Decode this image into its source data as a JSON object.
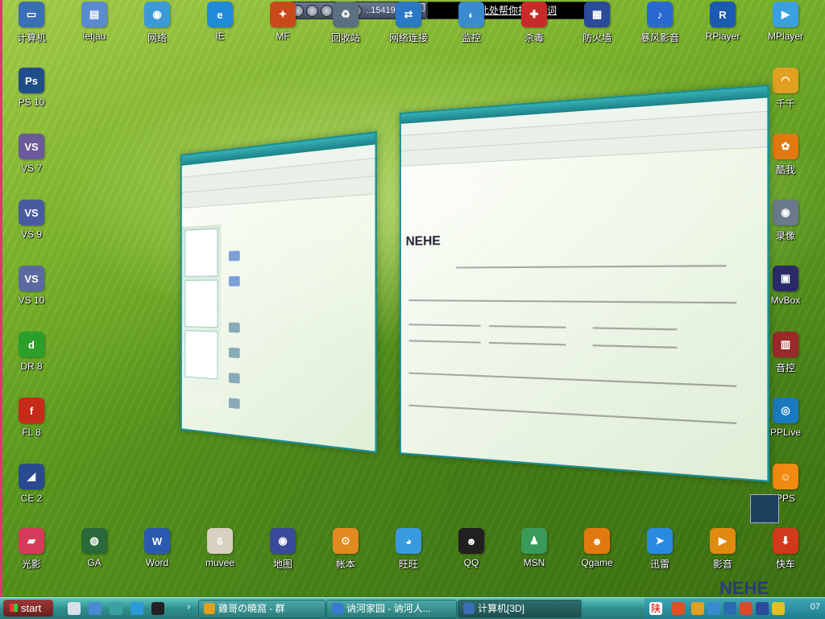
{
  "desktop": {
    "icons": [
      {
        "label": "计算机",
        "glyph": "▭",
        "color": "#3a6fb5",
        "col": 0,
        "row": 0
      },
      {
        "label": "letjau",
        "glyph": "▤",
        "color": "#5a8ad0",
        "col": 1,
        "row": 0
      },
      {
        "label": "网络",
        "glyph": "◉",
        "color": "#3d9ad8",
        "col": 2,
        "row": 0
      },
      {
        "label": "IE",
        "glyph": "e",
        "color": "#1f8ad8",
        "col": 3,
        "row": 0
      },
      {
        "label": "MF",
        "glyph": "✦",
        "color": "#c84a1a",
        "col": 4,
        "row": 0
      },
      {
        "label": "回收站",
        "glyph": "♻",
        "color": "#5a7080",
        "col": 5,
        "row": 0
      },
      {
        "label": "网络连接",
        "glyph": "⇄",
        "color": "#2b78c4",
        "col": 6,
        "row": 0
      },
      {
        "label": "监控",
        "glyph": "◐",
        "color": "#3a8ad0",
        "col": 7,
        "row": 0
      },
      {
        "label": "杀毒",
        "glyph": "✚",
        "color": "#c82a2a",
        "col": 8,
        "row": 0
      },
      {
        "label": "防火墙",
        "glyph": "▦",
        "color": "#2a4a9a",
        "col": 9,
        "row": 0
      },
      {
        "label": "暴风影音",
        "glyph": "♪",
        "color": "#2a6ad0",
        "col": 10,
        "row": 0
      },
      {
        "label": "RPlayer",
        "glyph": "R",
        "color": "#1a5ab0",
        "col": 11,
        "row": 0
      },
      {
        "label": "MPlayer",
        "glyph": "▶",
        "color": "#3aa0e0",
        "col": 12,
        "row": 0
      },
      {
        "label": "PS 10",
        "glyph": "Ps",
        "color": "#1f4d8a",
        "col": 0,
        "row": 1
      },
      {
        "label": "VS 7",
        "glyph": "VS",
        "color": "#6a5a9a",
        "col": 0,
        "row": 2
      },
      {
        "label": "VS 9",
        "glyph": "VS",
        "color": "#4a5aa0",
        "col": 0,
        "row": 3
      },
      {
        "label": "VS 10",
        "glyph": "VS",
        "color": "#5a6aa0",
        "col": 0,
        "row": 4
      },
      {
        "label": "DR 8",
        "glyph": "d",
        "color": "#2aa02a",
        "col": 0,
        "row": 5
      },
      {
        "label": "FL 8",
        "glyph": "f",
        "color": "#c82a1a",
        "col": 0,
        "row": 6
      },
      {
        "label": "CE 2",
        "glyph": "◢",
        "color": "#2a4a90",
        "col": 0,
        "row": 7
      },
      {
        "label": "千千",
        "glyph": "◠",
        "color": "#e0a020",
        "col": 12,
        "row": 1
      },
      {
        "label": "酷我",
        "glyph": "✿",
        "color": "#e07a10",
        "col": 12,
        "row": 2
      },
      {
        "label": "录像",
        "glyph": "◉",
        "color": "#6a7a8a",
        "col": 12,
        "row": 3
      },
      {
        "label": "MvBox",
        "glyph": "▣",
        "color": "#2a2a6a",
        "col": 12,
        "row": 4
      },
      {
        "label": "音控",
        "glyph": "▥",
        "color": "#9a2a2a",
        "col": 12,
        "row": 5
      },
      {
        "label": "PPLive",
        "glyph": "◎",
        "color": "#1a7ac0",
        "col": 12,
        "row": 6
      },
      {
        "label": "PPS",
        "glyph": "☺",
        "color": "#f08a10",
        "col": 12,
        "row": 7
      },
      {
        "label": "光影",
        "glyph": "▰",
        "color": "#d83a5a",
        "col": 0,
        "row": 8
      },
      {
        "label": "GA",
        "glyph": "◍",
        "color": "#2a6a3a",
        "col": 1,
        "row": 8
      },
      {
        "label": "Word",
        "glyph": "W",
        "color": "#2a5ab0",
        "col": 2,
        "row": 8
      },
      {
        "label": "muvee",
        "glyph": "6",
        "color": "#d8d0c0",
        "col": 3,
        "row": 8
      },
      {
        "label": "地图",
        "glyph": "◉",
        "color": "#3a4a9a",
        "col": 4,
        "row": 8
      },
      {
        "label": "帐本",
        "glyph": "⊙",
        "color": "#e08a20",
        "col": 5,
        "row": 8
      },
      {
        "label": "旺旺",
        "glyph": "◕",
        "color": "#3a9ae0",
        "col": 6,
        "row": 8
      },
      {
        "label": "QQ",
        "glyph": "☻",
        "color": "#202020",
        "col": 7,
        "row": 8
      },
      {
        "label": "MSN",
        "glyph": "♟",
        "color": "#3a9a5a",
        "col": 8,
        "row": 8
      },
      {
        "label": "Qgame",
        "glyph": "☻",
        "color": "#e07a10",
        "col": 9,
        "row": 8
      },
      {
        "label": "迅雷",
        "glyph": "➤",
        "color": "#2a8ae0",
        "col": 10,
        "row": 8
      },
      {
        "label": "影音",
        "glyph": "▶",
        "color": "#e08a10",
        "col": 11,
        "row": 8
      },
      {
        "label": "快车",
        "glyph": "⬇",
        "color": "#d03a1a",
        "col": 12,
        "row": 8
      }
    ]
  },
  "player": {
    "readout": "..15419163"
  },
  "lyrics_link": "点击此处帮你找到歌词",
  "win_b": {
    "logo": "NEHE"
  },
  "taskbar": {
    "start_label": "start",
    "tasks": [
      {
        "label": "雞哥の曉窩 - 群",
        "color": "#e0a020"
      },
      {
        "label": "讷河家园 - 讷河人...",
        "color": "#3a7ad0"
      },
      {
        "label": "计算机[3D]",
        "color": "#3a6fb5",
        "active": true
      }
    ],
    "clock": "07",
    "brand": "NEHE"
  }
}
